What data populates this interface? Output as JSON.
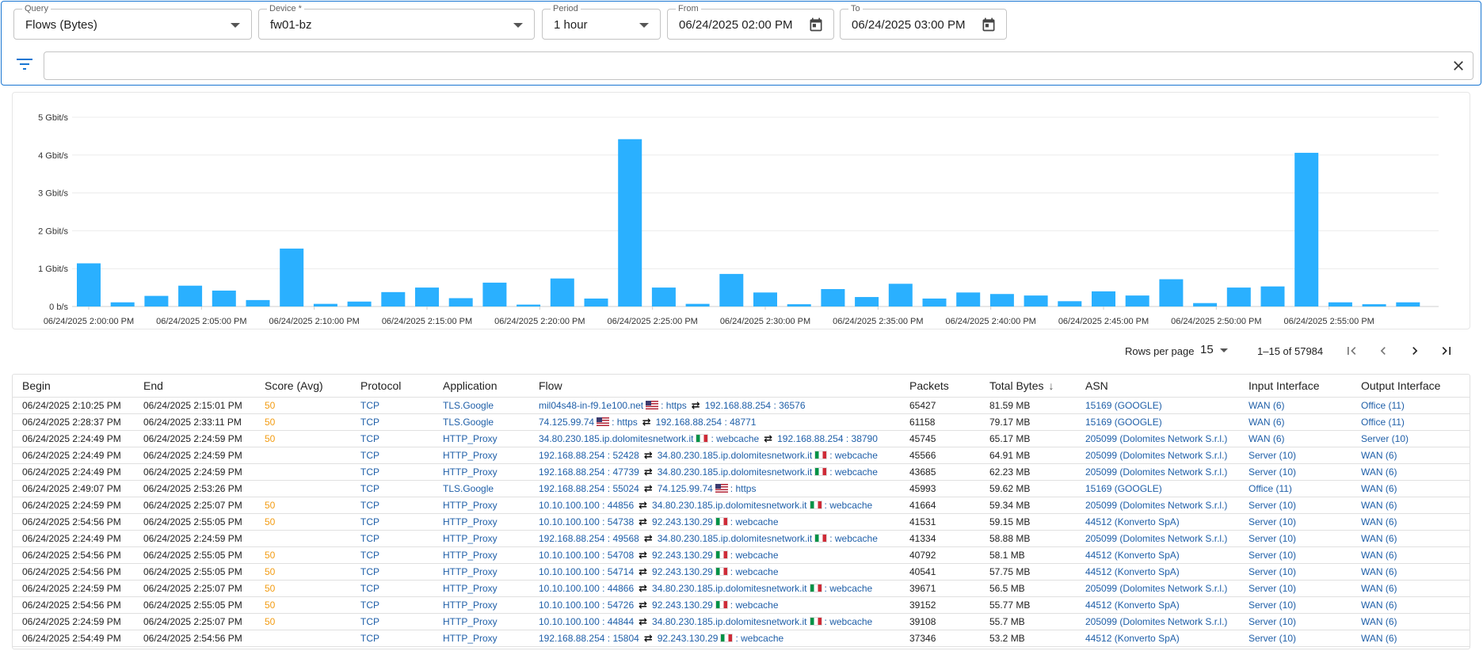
{
  "filters": {
    "query": {
      "label": "Query",
      "value": "Flows (Bytes)"
    },
    "device": {
      "label": "Device *",
      "value": "fw01-bz"
    },
    "period": {
      "label": "Period",
      "value": "1 hour"
    },
    "from": {
      "label": "From",
      "value": "06/24/2025 02:00 PM"
    },
    "to": {
      "label": "To",
      "value": "06/24/2025 03:00 PM"
    },
    "search_value": ""
  },
  "chart_data": {
    "type": "bar",
    "title": "",
    "ylabel": "",
    "xlabel": "",
    "y_unit": "Gbit/s",
    "ylim": [
      0,
      5
    ],
    "yticks": [
      "0 b/s",
      "1 Gbit/s",
      "2 Gbit/s",
      "3 Gbit/s",
      "4 Gbit/s",
      "5 Gbit/s"
    ],
    "xticks": [
      "06/24/2025 2:00:00 PM",
      "06/24/2025 2:05:00 PM",
      "06/24/2025 2:10:00 PM",
      "06/24/2025 2:15:00 PM",
      "06/24/2025 2:20:00 PM",
      "06/24/2025 2:25:00 PM",
      "06/24/2025 2:30:00 PM",
      "06/24/2025 2:35:00 PM",
      "06/24/2025 2:40:00 PM",
      "06/24/2025 2:45:00 PM",
      "06/24/2025 2:50:00 PM",
      "06/24/2025 2:55:00 PM"
    ],
    "bar_interval_minutes": 1.5,
    "values": [
      1.14,
      0.11,
      0.28,
      0.55,
      0.42,
      0.17,
      1.53,
      0.07,
      0.13,
      0.38,
      0.5,
      0.22,
      0.63,
      0.05,
      0.74,
      0.21,
      4.42,
      0.5,
      0.07,
      0.86,
      0.37,
      0.06,
      0.46,
      0.25,
      0.6,
      0.21,
      0.37,
      0.33,
      0.29,
      0.14,
      0.4,
      0.29,
      0.72,
      0.09,
      0.5,
      0.53,
      4.06,
      0.11,
      0.06,
      0.11
    ],
    "color": "#2ab0ff",
    "grid": true
  },
  "pagination": {
    "rows_per_page_label": "Rows per page",
    "rows_per_page": "15",
    "range": "1–15 of 57984"
  },
  "table": {
    "columns": [
      "Begin",
      "End",
      "Score (Avg)",
      "Protocol",
      "Application",
      "Flow",
      "Packets",
      "Total Bytes",
      "ASN",
      "Input Interface",
      "Output Interface"
    ],
    "rows": [
      {
        "begin": "06/24/2025 2:10:25 PM",
        "end": "06/24/2025 2:15:01 PM",
        "score": "50",
        "protocol": "TCP",
        "app": "TLS.Google",
        "src": "mil04s48-in-f9.1e100.net",
        "src_flag": "us",
        "src_port": "https",
        "dst": "192.168.88.254",
        "dst_flag": "",
        "dst_port": "36576",
        "packets": "65427",
        "bytes": "81.59 MB",
        "asn": "15169 (GOOGLE)",
        "in": "WAN (6)",
        "out": "Office (11)"
      },
      {
        "begin": "06/24/2025 2:28:37 PM",
        "end": "06/24/2025 2:33:11 PM",
        "score": "50",
        "protocol": "TCP",
        "app": "TLS.Google",
        "src": "74.125.99.74",
        "src_flag": "us",
        "src_port": "https",
        "dst": "192.168.88.254",
        "dst_flag": "",
        "dst_port": "48771",
        "packets": "61158",
        "bytes": "79.17 MB",
        "asn": "15169 (GOOGLE)",
        "in": "WAN (6)",
        "out": "Office (11)"
      },
      {
        "begin": "06/24/2025 2:24:49 PM",
        "end": "06/24/2025 2:24:59 PM",
        "score": "50",
        "protocol": "TCP",
        "app": "HTTP_Proxy",
        "src": "34.80.230.185.ip.dolomitesnetwork.it",
        "src_flag": "it",
        "src_port": "webcache",
        "dst": "192.168.88.254",
        "dst_flag": "",
        "dst_port": "38790",
        "packets": "45745",
        "bytes": "65.17 MB",
        "asn": "205099 (Dolomites Network S.r.l.)",
        "in": "WAN (6)",
        "out": "Server (10)"
      },
      {
        "begin": "06/24/2025 2:24:49 PM",
        "end": "06/24/2025 2:24:59 PM",
        "score": "",
        "protocol": "TCP",
        "app": "HTTP_Proxy",
        "src": "192.168.88.254",
        "src_flag": "",
        "src_port": "52428",
        "dst": "34.80.230.185.ip.dolomitesnetwork.it",
        "dst_flag": "it",
        "dst_port": "webcache",
        "packets": "45566",
        "bytes": "64.91 MB",
        "asn": "205099 (Dolomites Network S.r.l.)",
        "in": "Server (10)",
        "out": "WAN (6)"
      },
      {
        "begin": "06/24/2025 2:24:49 PM",
        "end": "06/24/2025 2:24:59 PM",
        "score": "",
        "protocol": "TCP",
        "app": "HTTP_Proxy",
        "src": "192.168.88.254",
        "src_flag": "",
        "src_port": "47739",
        "dst": "34.80.230.185.ip.dolomitesnetwork.it",
        "dst_flag": "it",
        "dst_port": "webcache",
        "packets": "43685",
        "bytes": "62.23 MB",
        "asn": "205099 (Dolomites Network S.r.l.)",
        "in": "Server (10)",
        "out": "WAN (6)"
      },
      {
        "begin": "06/24/2025 2:49:07 PM",
        "end": "06/24/2025 2:53:26 PM",
        "score": "",
        "protocol": "TCP",
        "app": "TLS.Google",
        "src": "192.168.88.254",
        "src_flag": "",
        "src_port": "55024",
        "dst": "74.125.99.74",
        "dst_flag": "us",
        "dst_port": "https",
        "packets": "45993",
        "bytes": "59.62 MB",
        "asn": "15169 (GOOGLE)",
        "in": "Office (11)",
        "out": "WAN (6)"
      },
      {
        "begin": "06/24/2025 2:24:59 PM",
        "end": "06/24/2025 2:25:07 PM",
        "score": "50",
        "protocol": "TCP",
        "app": "HTTP_Proxy",
        "src": "10.10.100.100",
        "src_flag": "",
        "src_port": "44856",
        "dst": "34.80.230.185.ip.dolomitesnetwork.it",
        "dst_flag": "it",
        "dst_port": "webcache",
        "packets": "41664",
        "bytes": "59.34 MB",
        "asn": "205099 (Dolomites Network S.r.l.)",
        "in": "Server (10)",
        "out": "WAN (6)"
      },
      {
        "begin": "06/24/2025 2:54:56 PM",
        "end": "06/24/2025 2:55:05 PM",
        "score": "50",
        "protocol": "TCP",
        "app": "HTTP_Proxy",
        "src": "10.10.100.100",
        "src_flag": "",
        "src_port": "54738",
        "dst": "92.243.130.29",
        "dst_flag": "it",
        "dst_port": "webcache",
        "packets": "41531",
        "bytes": "59.15 MB",
        "asn": "44512 (Konverto SpA)",
        "in": "Server (10)",
        "out": "WAN (6)"
      },
      {
        "begin": "06/24/2025 2:24:49 PM",
        "end": "06/24/2025 2:24:59 PM",
        "score": "",
        "protocol": "TCP",
        "app": "HTTP_Proxy",
        "src": "192.168.88.254",
        "src_flag": "",
        "src_port": "49568",
        "dst": "34.80.230.185.ip.dolomitesnetwork.it",
        "dst_flag": "it",
        "dst_port": "webcache",
        "packets": "41334",
        "bytes": "58.88 MB",
        "asn": "205099 (Dolomites Network S.r.l.)",
        "in": "Server (10)",
        "out": "WAN (6)"
      },
      {
        "begin": "06/24/2025 2:54:56 PM",
        "end": "06/24/2025 2:55:05 PM",
        "score": "50",
        "protocol": "TCP",
        "app": "HTTP_Proxy",
        "src": "10.10.100.100",
        "src_flag": "",
        "src_port": "54708",
        "dst": "92.243.130.29",
        "dst_flag": "it",
        "dst_port": "webcache",
        "packets": "40792",
        "bytes": "58.1 MB",
        "asn": "44512 (Konverto SpA)",
        "in": "Server (10)",
        "out": "WAN (6)"
      },
      {
        "begin": "06/24/2025 2:54:56 PM",
        "end": "06/24/2025 2:55:05 PM",
        "score": "50",
        "protocol": "TCP",
        "app": "HTTP_Proxy",
        "src": "10.10.100.100",
        "src_flag": "",
        "src_port": "54714",
        "dst": "92.243.130.29",
        "dst_flag": "it",
        "dst_port": "webcache",
        "packets": "40541",
        "bytes": "57.75 MB",
        "asn": "44512 (Konverto SpA)",
        "in": "Server (10)",
        "out": "WAN (6)"
      },
      {
        "begin": "06/24/2025 2:24:59 PM",
        "end": "06/24/2025 2:25:07 PM",
        "score": "50",
        "protocol": "TCP",
        "app": "HTTP_Proxy",
        "src": "10.10.100.100",
        "src_flag": "",
        "src_port": "44866",
        "dst": "34.80.230.185.ip.dolomitesnetwork.it",
        "dst_flag": "it",
        "dst_port": "webcache",
        "packets": "39671",
        "bytes": "56.5 MB",
        "asn": "205099 (Dolomites Network S.r.l.)",
        "in": "Server (10)",
        "out": "WAN (6)"
      },
      {
        "begin": "06/24/2025 2:54:56 PM",
        "end": "06/24/2025 2:55:05 PM",
        "score": "50",
        "protocol": "TCP",
        "app": "HTTP_Proxy",
        "src": "10.10.100.100",
        "src_flag": "",
        "src_port": "54726",
        "dst": "92.243.130.29",
        "dst_flag": "it",
        "dst_port": "webcache",
        "packets": "39152",
        "bytes": "55.77 MB",
        "asn": "44512 (Konverto SpA)",
        "in": "Server (10)",
        "out": "WAN (6)"
      },
      {
        "begin": "06/24/2025 2:24:59 PM",
        "end": "06/24/2025 2:25:07 PM",
        "score": "50",
        "protocol": "TCP",
        "app": "HTTP_Proxy",
        "src": "10.10.100.100",
        "src_flag": "",
        "src_port": "44844",
        "dst": "34.80.230.185.ip.dolomitesnetwork.it",
        "dst_flag": "it",
        "dst_port": "webcache",
        "packets": "39108",
        "bytes": "55.7 MB",
        "asn": "205099 (Dolomites Network S.r.l.)",
        "in": "Server (10)",
        "out": "WAN (6)"
      },
      {
        "begin": "06/24/2025 2:54:49 PM",
        "end": "06/24/2025 2:54:56 PM",
        "score": "",
        "protocol": "TCP",
        "app": "HTTP_Proxy",
        "src": "192.168.88.254",
        "src_flag": "",
        "src_port": "15804",
        "dst": "92.243.130.29",
        "dst_flag": "it",
        "dst_port": "webcache",
        "packets": "37346",
        "bytes": "53.2 MB",
        "asn": "44512 (Konverto SpA)",
        "in": "Server (10)",
        "out": "WAN (6)"
      }
    ]
  }
}
